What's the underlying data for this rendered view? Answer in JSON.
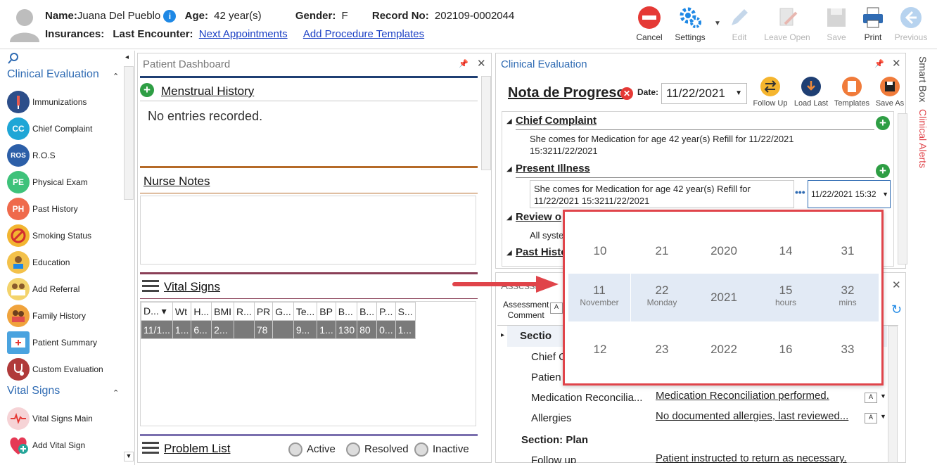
{
  "patient": {
    "name_label": "Name:",
    "name": "Juana Del Pueblo",
    "age_label": "Age:",
    "age": "42 year(s)",
    "gender_label": "Gender:",
    "gender": "F",
    "record_label": "Record No:",
    "record": "202109-0002044",
    "insurances_label": "Insurances:",
    "last_encounter_label": "Last Encounter:",
    "next_appointments": "Next Appointments",
    "add_procedure_templates": "Add Procedure Templates"
  },
  "toolbar": {
    "cancel": "Cancel",
    "settings": "Settings",
    "edit": "Edit",
    "leave_open": "Leave Open",
    "save": "Save",
    "print": "Print",
    "previous": "Previous"
  },
  "sidebar": {
    "section1": "Clinical Evaluation",
    "items1": [
      {
        "label": "Immunizations",
        "badge": ""
      },
      {
        "label": "Chief Complaint",
        "badge": "CC"
      },
      {
        "label": "R.O.S",
        "badge": "ROS"
      },
      {
        "label": "Physical Exam",
        "badge": "PE"
      },
      {
        "label": "Past History",
        "badge": "PH"
      },
      {
        "label": "Smoking Status",
        "badge": ""
      },
      {
        "label": "Education",
        "badge": ""
      },
      {
        "label": "Add Referral",
        "badge": ""
      },
      {
        "label": "Family History",
        "badge": ""
      },
      {
        "label": "Patient Summary",
        "badge": ""
      },
      {
        "label": "Custom Evaluation",
        "badge": ""
      }
    ],
    "section2": "Vital Signs",
    "items2": [
      {
        "label": "Vital Signs Main"
      },
      {
        "label": "Add Vital Sign"
      }
    ]
  },
  "dashboard": {
    "title": "Patient Dashboard",
    "menstrual": "Menstrual History",
    "menstrual_empty": "No entries recorded.",
    "nurse": "Nurse Notes",
    "vitals": "Vital Signs",
    "vitals_headers": [
      "D...",
      "Wt",
      "H...",
      "BMI",
      "R...",
      "PR",
      "G...",
      "Te...",
      "BP",
      "B...",
      "B...",
      "P...",
      "S..."
    ],
    "vitals_row": [
      "11/1...",
      "1...",
      "6...",
      "2...",
      "",
      "78",
      "",
      "9...",
      "1...",
      "130",
      "80",
      "0...",
      "1..."
    ],
    "problems": "Problem List",
    "radio_active": "Active",
    "radio_resolved": "Resolved",
    "radio_inactive": "Inactive"
  },
  "clinical": {
    "title": "Clinical Evaluation",
    "note_title": "Nota de Progreso",
    "date_label": "Date:",
    "date_value": "11/22/2021",
    "follow_up": "Follow Up",
    "load_last": "Load Last",
    "templates": "Templates",
    "save_as": "Save As",
    "chief_complaint": "Chief Complaint",
    "chief_text": "She comes for Medication for age 42 year(s) Refill for 11/22/2021 15:3211/22/2021",
    "present_illness": "Present Illness",
    "present_text": "She comes for Medication for age 42 year(s) Refill for 11/22/2021 15:3211/22/2021",
    "present_datetime": "11/22/2021 15:32",
    "review": "Review o",
    "review_text": "All syste",
    "past_history": "Past Histo"
  },
  "assessment": {
    "header": "Assessm",
    "comment_label_1": "Assessment",
    "comment_label_2": "Comment",
    "section_label": "Sectio",
    "row_chief": "Chief C",
    "row_patient": "Patien",
    "row_med": "Medication Reconcilia...",
    "row_med_value": "Medication Reconciliation performed.",
    "row_allergies": "Allergies",
    "row_allergies_value": "No documented allergies, last reviewed...",
    "section_plan": "Section: Plan",
    "row_follow": "Follow up",
    "row_follow_value": "Patient instructed to return as necessary."
  },
  "smart_box": "Smart Box",
  "clinical_alerts": "Clinical Alerts",
  "picker": {
    "above": [
      "10",
      "21",
      "2020",
      "14",
      "31"
    ],
    "selected": [
      "11",
      "22",
      "2021",
      "15",
      "32"
    ],
    "selected_sub": [
      "November",
      "Monday",
      "",
      "hours",
      "mins"
    ],
    "below": [
      "12",
      "23",
      "2022",
      "16",
      "33"
    ]
  },
  "colors": {
    "accent_blue": "#2f6bb3",
    "alert_red": "#e0444a",
    "green_add": "#2e9e44"
  }
}
